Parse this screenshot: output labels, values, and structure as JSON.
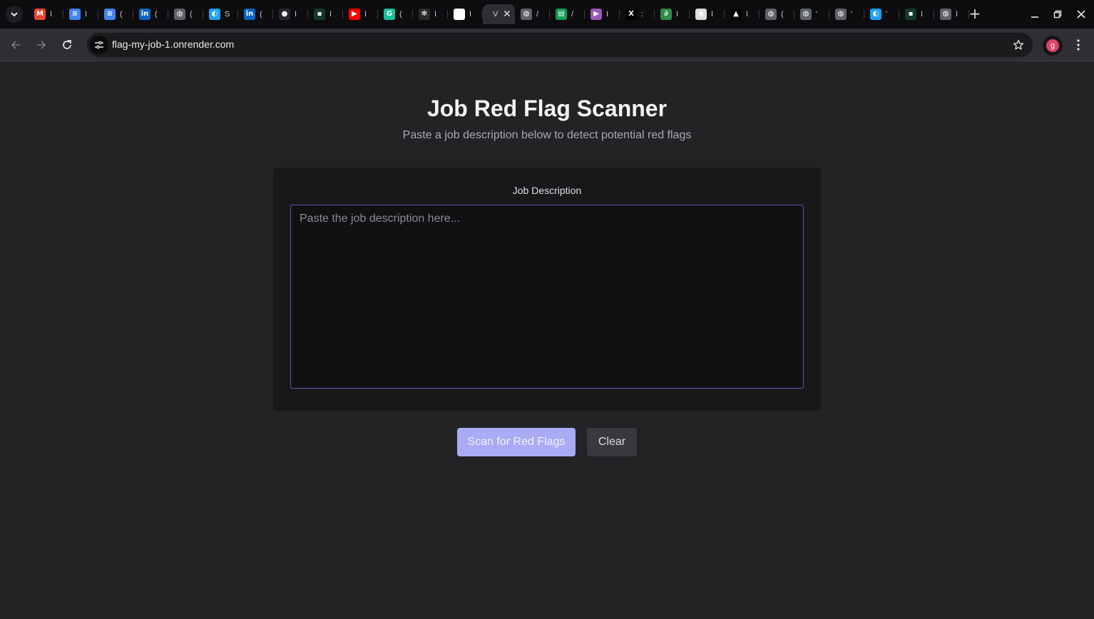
{
  "browser": {
    "tabs": [
      {
        "icon": "gmail-icon",
        "glyph": "M",
        "color": "#ea4335",
        "title": "I"
      },
      {
        "icon": "google-docs-icon",
        "glyph": "≡",
        "color": "#4285f4",
        "title": "I"
      },
      {
        "icon": "google-docs-icon",
        "glyph": "≡",
        "color": "#4285f4",
        "title": "("
      },
      {
        "icon": "linkedin-icon",
        "glyph": "in",
        "color": "#0a66c2",
        "title": "("
      },
      {
        "icon": "globe-icon",
        "glyph": "◍",
        "color": "#5f6368",
        "title": "("
      },
      {
        "icon": "blue-app-icon",
        "glyph": "◐",
        "color": "#1da1f2",
        "title": "S"
      },
      {
        "icon": "linkedin-icon",
        "glyph": "in",
        "color": "#0a66c2",
        "title": "("
      },
      {
        "icon": "github-icon",
        "glyph": "●",
        "color": "#24292e",
        "title": "I"
      },
      {
        "icon": "dark-app-icon",
        "glyph": "▪",
        "color": "#0f3d2a",
        "title": "I"
      },
      {
        "icon": "youtube-icon",
        "glyph": "▶",
        "color": "#ff0000",
        "title": "I"
      },
      {
        "icon": "grammarly-icon",
        "glyph": "G",
        "color": "#15c39a",
        "title": "("
      },
      {
        "icon": "openai-icon",
        "glyph": "✻",
        "color": "#2a2a2a",
        "title": "I"
      },
      {
        "icon": "white-app-icon",
        "glyph": "◢",
        "color": "#ffffff",
        "title": "I"
      },
      {
        "icon": "active-tab-icon",
        "glyph": "",
        "color": "transparent",
        "title": "V",
        "active": true
      },
      {
        "icon": "globe-icon",
        "glyph": "◍",
        "color": "#5f6368",
        "title": "/"
      },
      {
        "icon": "green-app-icon",
        "glyph": "▤",
        "color": "#0f9d58",
        "title": "/"
      },
      {
        "icon": "purple-play-icon",
        "glyph": "▶",
        "color": "#9b59b6",
        "title": "I"
      },
      {
        "icon": "x-icon",
        "glyph": "X",
        "color": "#000000",
        "title": ":"
      },
      {
        "icon": "geeksforgeeks-icon",
        "glyph": "∂",
        "color": "#2f8d46",
        "title": "I"
      },
      {
        "icon": "chrome-icon",
        "glyph": "◉",
        "color": "#dedede",
        "title": "I"
      },
      {
        "icon": "triangle-icon",
        "glyph": "▲",
        "color": "#000000",
        "title": "I"
      },
      {
        "icon": "globe-icon",
        "glyph": "◍",
        "color": "#5f6368",
        "title": "("
      },
      {
        "icon": "globe-icon",
        "glyph": "◍",
        "color": "#5f6368",
        "title": "'"
      },
      {
        "icon": "globe-icon",
        "glyph": "◍",
        "color": "#5f6368",
        "title": "'"
      },
      {
        "icon": "blue-app-icon",
        "glyph": "◐",
        "color": "#1da1f2",
        "title": "'"
      },
      {
        "icon": "dark-app-icon",
        "glyph": "▪",
        "color": "#0f3d2a",
        "title": "I"
      },
      {
        "icon": "globe-icon",
        "glyph": "◍",
        "color": "#5f6368",
        "title": "I"
      }
    ],
    "url": "flag-my-job-1.onrender.com",
    "profile_initial": "g"
  },
  "page": {
    "title": "Job Red Flag Scanner",
    "subtitle": "Paste a job description below to detect potential red flags",
    "field_label": "Job Description",
    "textarea_placeholder": "Paste the job description here...",
    "textarea_value": "",
    "scan_button": "Scan for Red Flags",
    "clear_button": "Clear"
  },
  "colors": {
    "background": "#232326",
    "card": "#18181b",
    "accent": "#a9abf5",
    "input_border": "#5c54b8"
  }
}
